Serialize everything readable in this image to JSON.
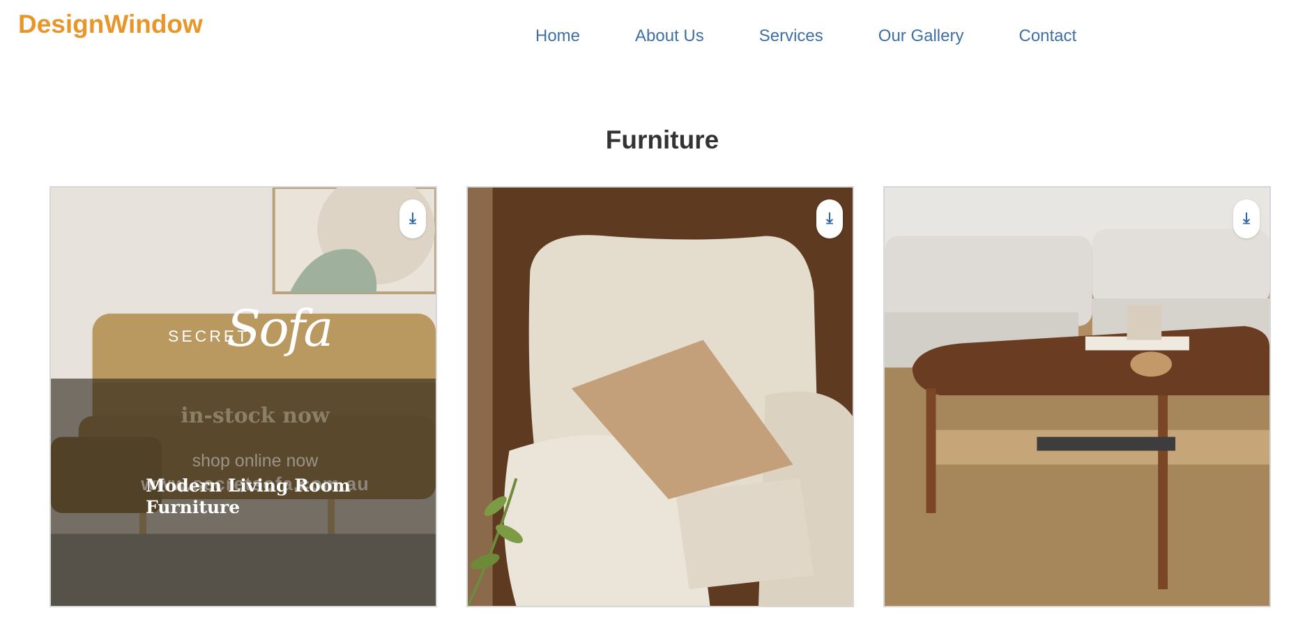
{
  "header": {
    "logo": "DesignWindow",
    "nav": [
      {
        "label": "Home"
      },
      {
        "label": "About Us"
      },
      {
        "label": "Services"
      },
      {
        "label": "Our Gallery"
      },
      {
        "label": "Contact"
      }
    ]
  },
  "section": {
    "title": "Furniture"
  },
  "gallery": {
    "cards": [
      {
        "image_brand_secret": "SECRET",
        "image_brand_sofa": "Sofa",
        "image_tagline": "in-stock now",
        "image_shop": "shop online now",
        "image_website": "www.secretsofa.com.au",
        "caption": "Modern Living Room Furniture",
        "download_icon": "download-icon"
      },
      {
        "download_icon": "download-icon"
      },
      {
        "download_icon": "download-icon"
      }
    ]
  },
  "colors": {
    "logo": "#e8962a",
    "nav_link": "#3f6fa3",
    "title": "#333333",
    "download_icon": "#2d67a8"
  }
}
